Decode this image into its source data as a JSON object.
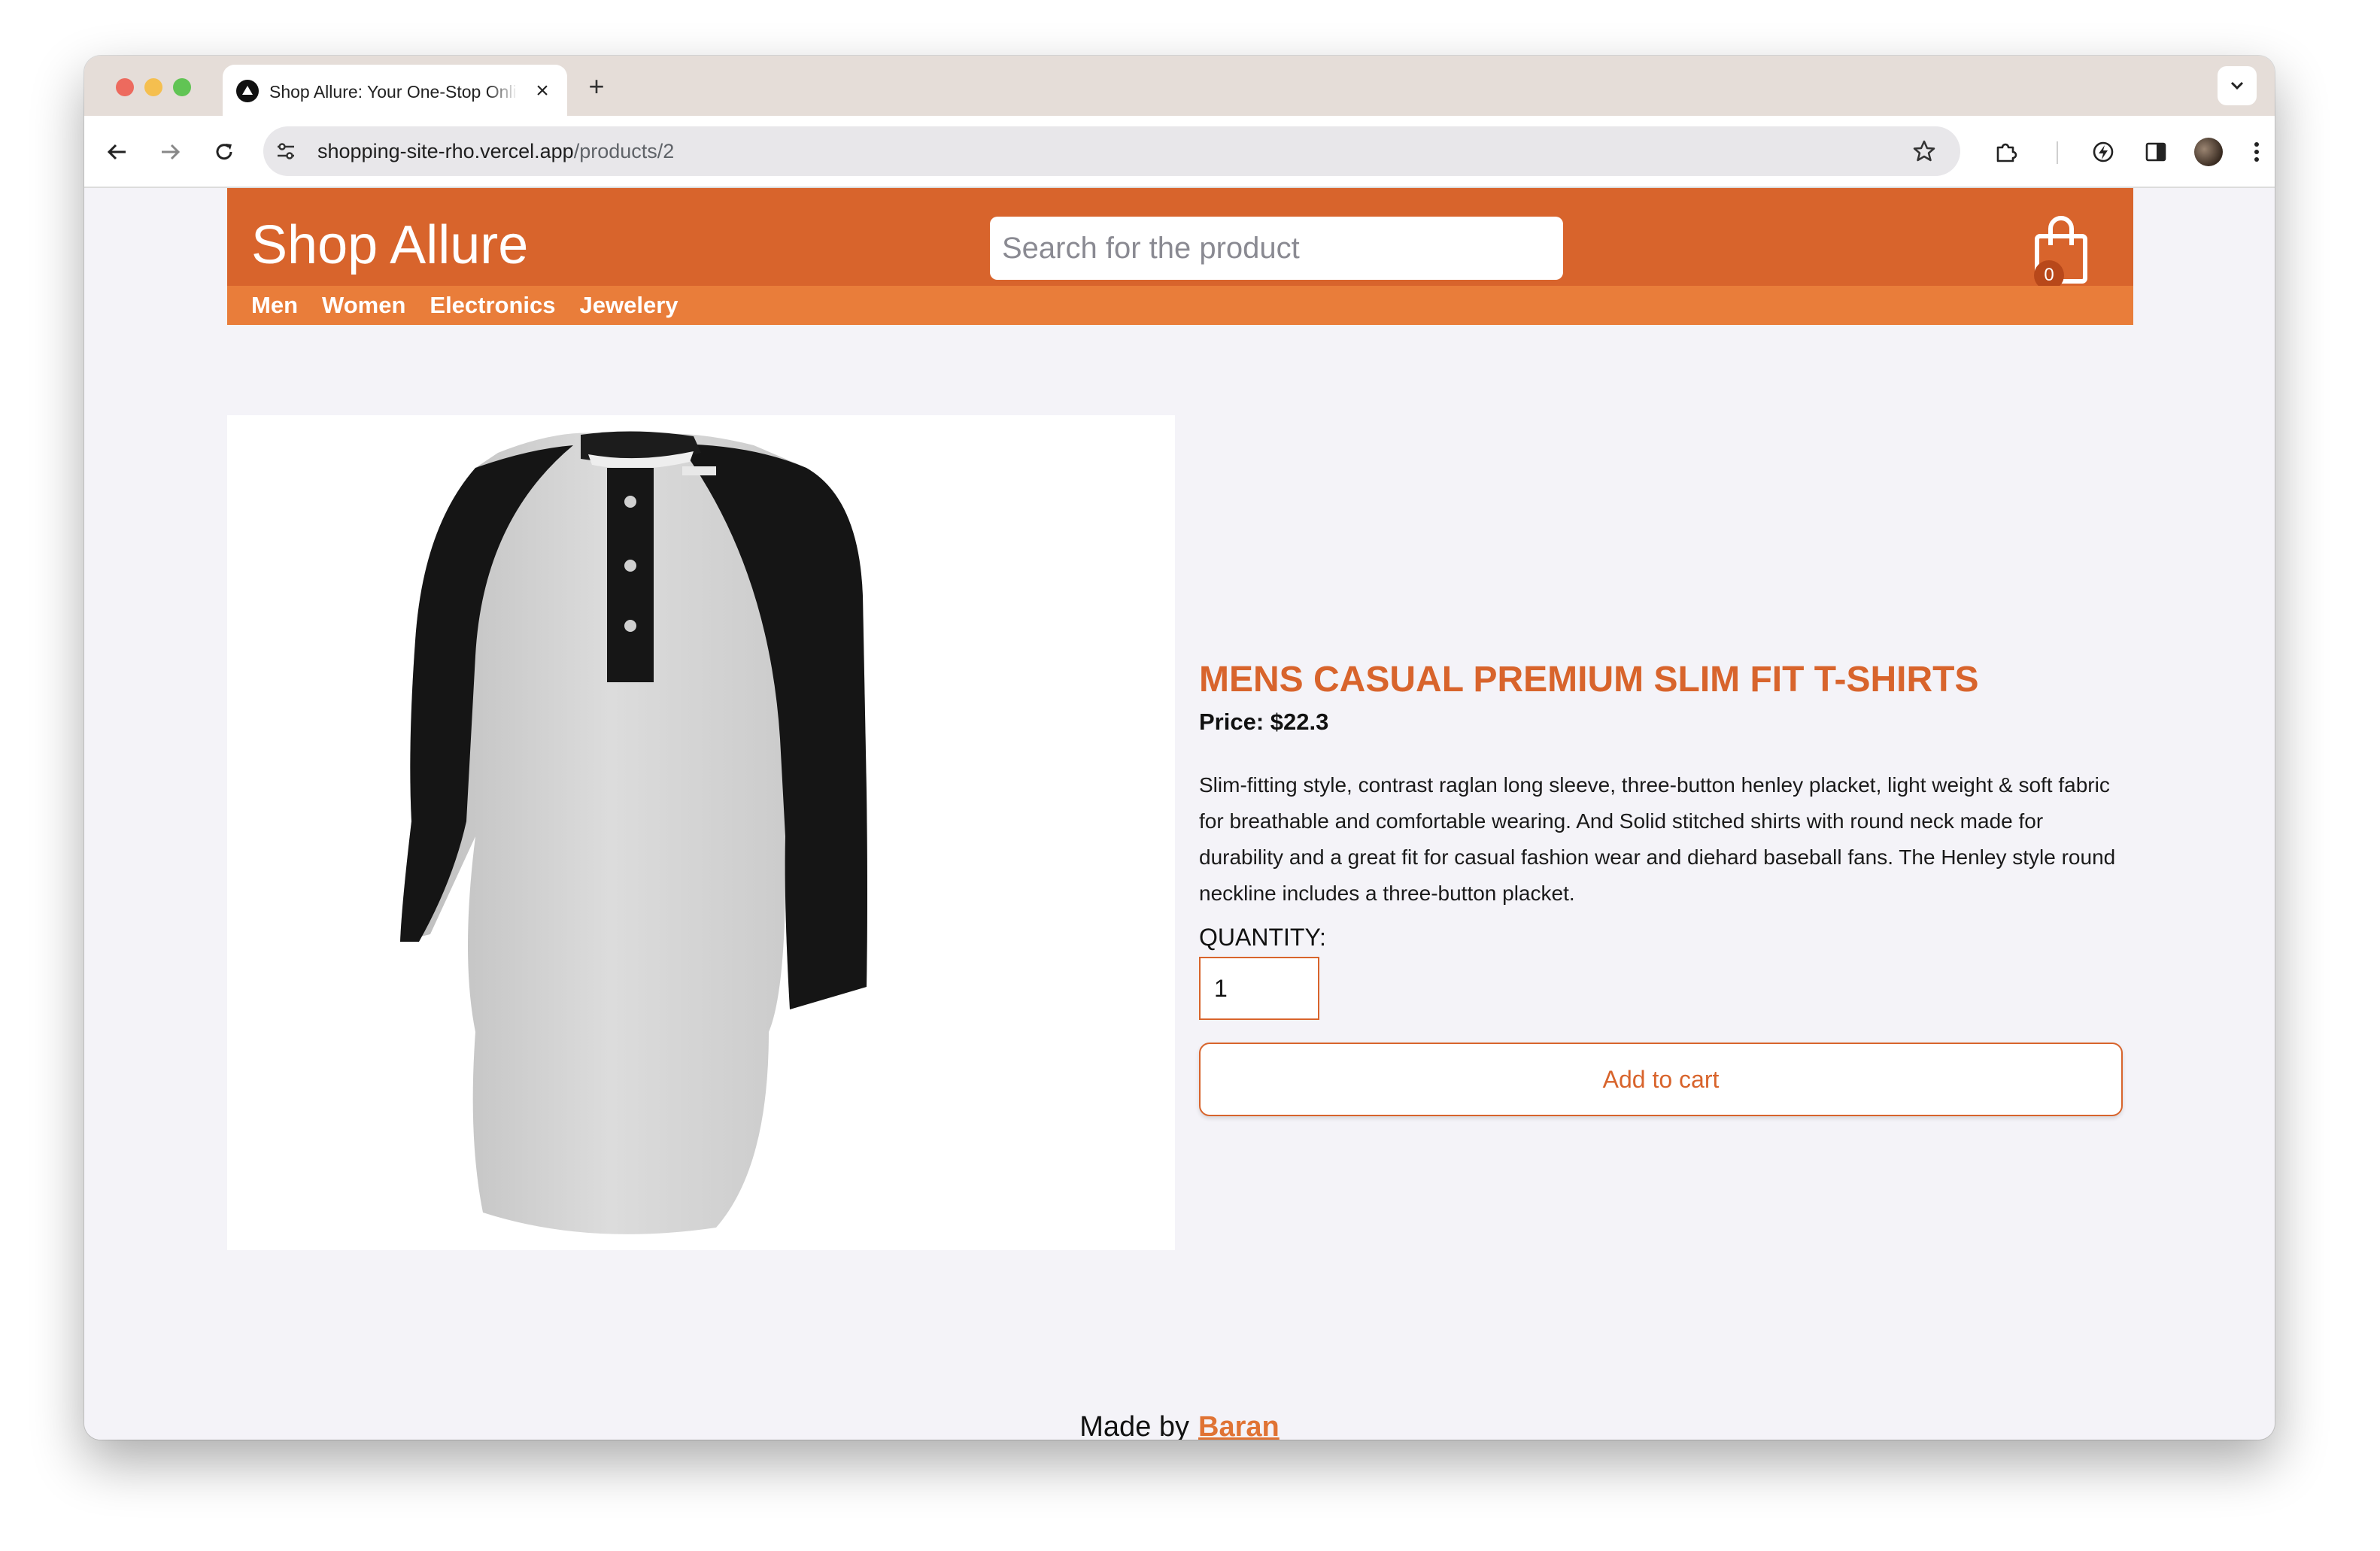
{
  "browser": {
    "tab_title": "Shop Allure: Your One-Stop Online Store",
    "close_symbol": "×",
    "new_tab_symbol": "+",
    "url_host": "shopping-site-rho.vercel.app",
    "url_path": "/products/2"
  },
  "header": {
    "brand": "Shop Allure",
    "search_placeholder": "Search for the product",
    "cart_count": "0",
    "nav": [
      "Men",
      "Women",
      "Electronics",
      "Jewelery"
    ]
  },
  "product": {
    "title": "MENS CASUAL PREMIUM SLIM FIT T-SHIRTS",
    "price": "Price: $22.3",
    "description": "Slim-fitting style, contrast raglan long sleeve, three-button henley placket, light weight & soft fabric for breathable and comfortable wearing. And Solid stitched shirts with round neck made for durability and a great fit for casual fashion wear and diehard baseball fans. The Henley style round neckline includes a three-button placket.",
    "quantity_label": "QUANTITY:",
    "quantity_value": "1",
    "add_to_cart": "Add to cart"
  },
  "footer": {
    "text": "Made by",
    "author": "Baran"
  },
  "colors": {
    "primary": "#d8642c",
    "nav_bar": "#e97d3a",
    "page_bg": "#f4f3f8"
  }
}
